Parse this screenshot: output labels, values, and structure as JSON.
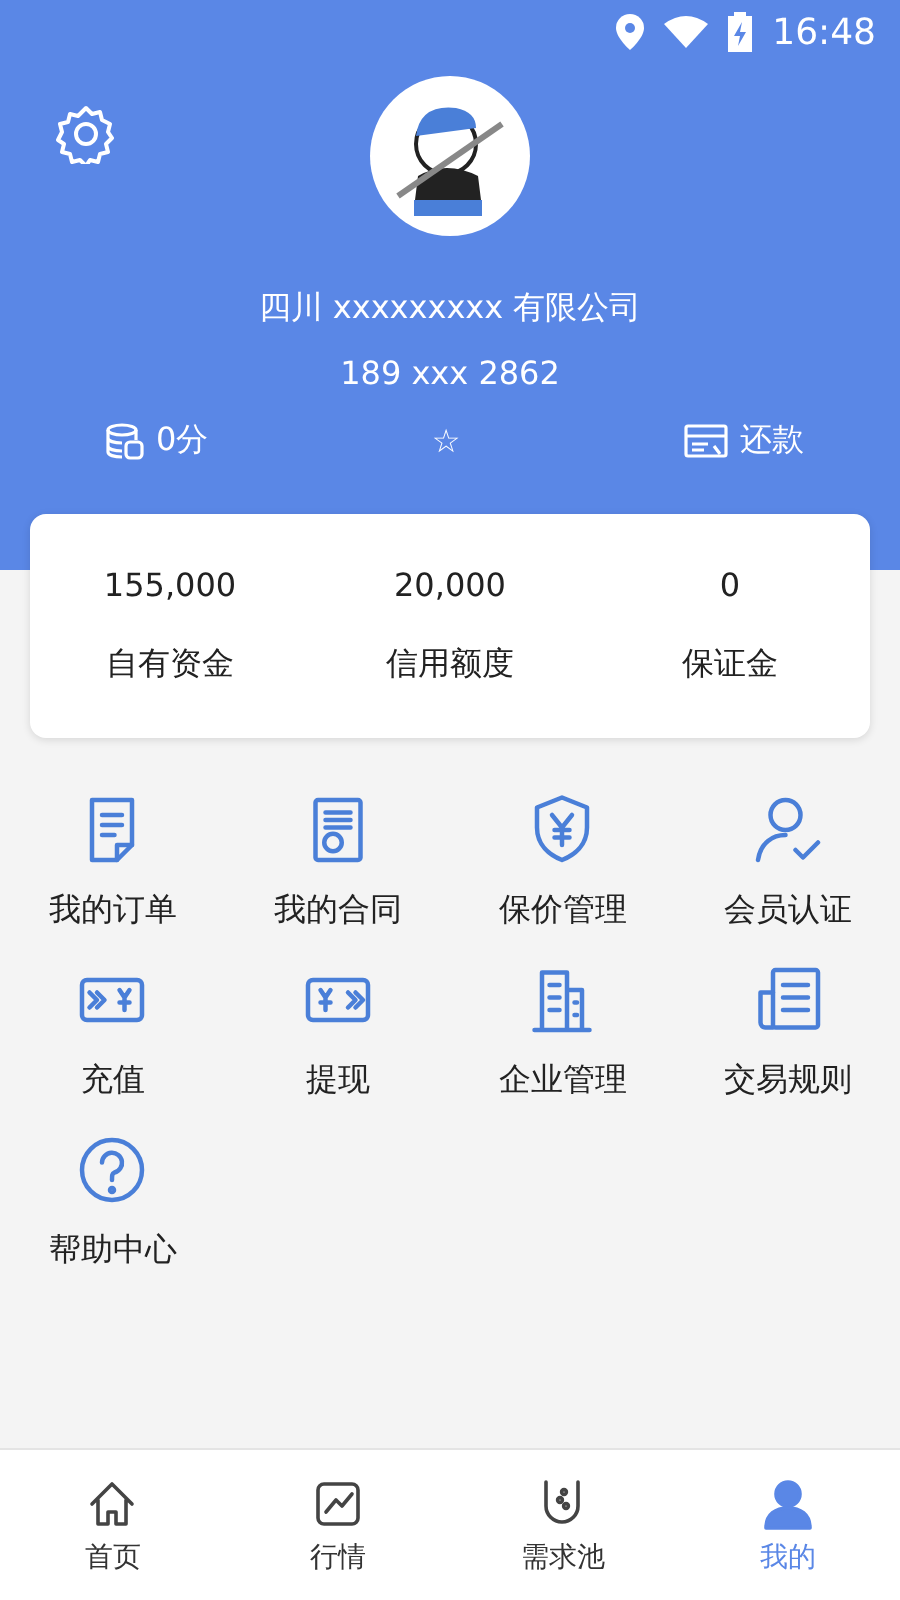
{
  "status_bar": {
    "time": "16:48"
  },
  "profile": {
    "company": "四川 xxxxxxxxx 有限公司",
    "phone": "189 xxx 2862"
  },
  "stats_row": {
    "points": "0分",
    "star": "☆",
    "repay": "还款"
  },
  "summary": [
    {
      "value": "155,000",
      "label": "自有资金"
    },
    {
      "value": "20,000",
      "label": "信用额度"
    },
    {
      "value": "0",
      "label": "保证金"
    }
  ],
  "menu": [
    {
      "label": "我的订单"
    },
    {
      "label": "我的合同"
    },
    {
      "label": "保价管理"
    },
    {
      "label": "会员认证"
    },
    {
      "label": "充值"
    },
    {
      "label": "提现"
    },
    {
      "label": "企业管理"
    },
    {
      "label": "交易规则"
    },
    {
      "label": "帮助中心"
    }
  ],
  "tab_bar": [
    {
      "label": "首页",
      "selected": false
    },
    {
      "label": "行情",
      "selected": false
    },
    {
      "label": "需求池",
      "selected": false
    },
    {
      "label": "我的",
      "selected": true
    }
  ]
}
